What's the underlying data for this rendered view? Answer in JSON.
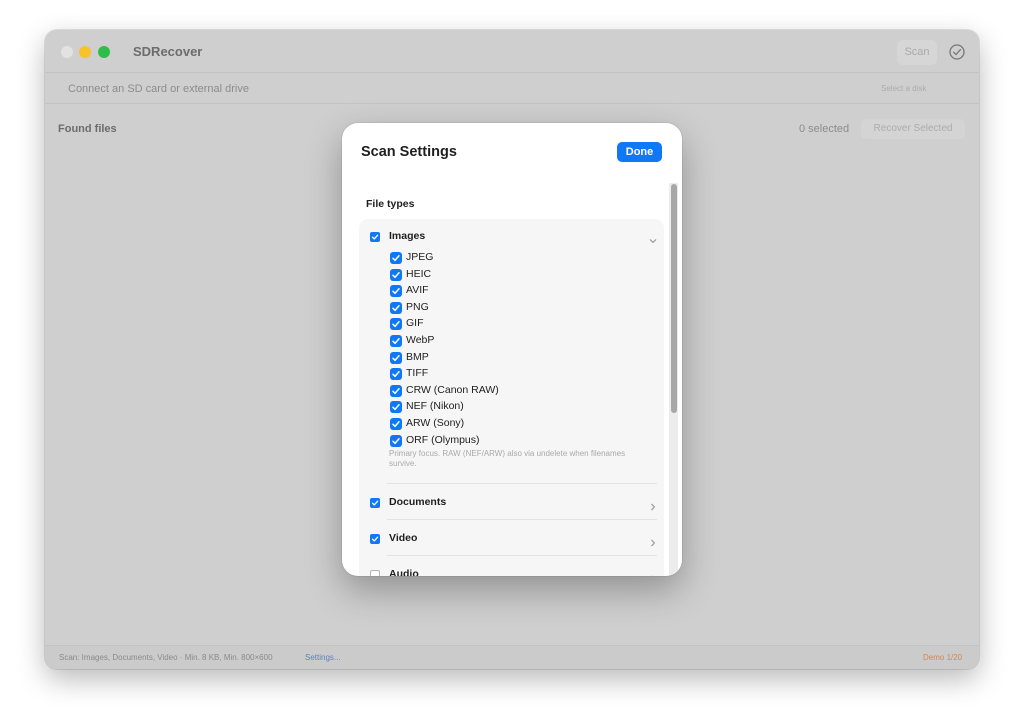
{
  "window": {
    "title": "SDRecover",
    "scan_label": "Scan",
    "drive_hint": "Connect an SD card or external drive",
    "disk_select": "Select a disk",
    "found_files": "Found files",
    "selected_count": "0 selected",
    "recover_label": "Recover Selected",
    "status": {
      "summary": "Scan: Images, Documents, Video · Min. 8 KB, Min. 800×600",
      "settings_link": "Settings...",
      "demo": "Demo 1/20"
    }
  },
  "sheet": {
    "title": "Scan Settings",
    "done_label": "Done",
    "file_types_label": "File types",
    "groups": [
      {
        "label": "Images",
        "checked": true,
        "expanded": true,
        "items": [
          {
            "label": "JPEG",
            "checked": true
          },
          {
            "label": "HEIC",
            "checked": true
          },
          {
            "label": "AVIF",
            "checked": true
          },
          {
            "label": "PNG",
            "checked": true
          },
          {
            "label": "GIF",
            "checked": true
          },
          {
            "label": "WebP",
            "checked": true
          },
          {
            "label": "BMP",
            "checked": true
          },
          {
            "label": "TIFF",
            "checked": true
          },
          {
            "label": "CRW (Canon RAW)",
            "checked": true
          },
          {
            "label": "NEF (Nikon)",
            "checked": true
          },
          {
            "label": "ARW (Sony)",
            "checked": true
          },
          {
            "label": "ORF (Olympus)",
            "checked": true
          }
        ],
        "note": "Primary focus. RAW (NEF/ARW) also via undelete when filenames survive."
      },
      {
        "label": "Documents",
        "checked": true,
        "expanded": false
      },
      {
        "label": "Video",
        "checked": true,
        "expanded": false
      },
      {
        "label": "Audio",
        "checked": false,
        "expanded": false
      }
    ]
  },
  "colors": {
    "accent": "#1178f5",
    "demo": "#d68842",
    "link": "#5d82c0"
  }
}
